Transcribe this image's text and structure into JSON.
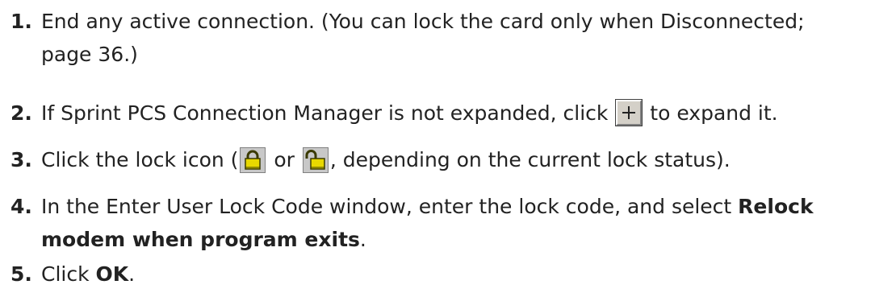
{
  "steps": [
    {
      "num": "1.",
      "line1": "End any active connection. (You can lock the card only when Disconnected;",
      "line2": "page 36.)"
    },
    {
      "num": "2.",
      "before_icon": "If Sprint PCS Connection Manager is not expanded, click ",
      "icon": "plus-expand-icon",
      "after_icon": " to expand it."
    },
    {
      "num": "3.",
      "before_icon1": "Click the lock icon (",
      "icon1": "lock-closed-icon",
      "between": " or ",
      "icon2": "lock-open-icon",
      "after_icons": ", depending on the current lock status)."
    },
    {
      "num": "4.",
      "line1_text": "In the Enter User Lock Code window, enter the lock code, and select ",
      "line1_bold": "Relock",
      "line2_bold": "modem when program exits",
      "line2_text": "."
    },
    {
      "num": "5.",
      "text": "Click ",
      "bold": "OK",
      "after": "."
    }
  ],
  "colors": {
    "text": "#222222",
    "lock_yellow": "#e8d800",
    "button_face": "#d4d0c8"
  }
}
